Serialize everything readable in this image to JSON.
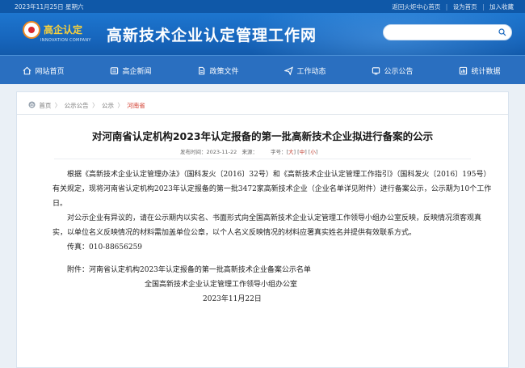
{
  "topbar": {
    "date": "2023年11月25日  星期六",
    "links": [
      "返回火炬中心首页",
      "设为首页",
      "加入收藏"
    ],
    "separator": "|"
  },
  "header": {
    "logo_cn": "高企认定",
    "logo_en": "INNOVATION COMPANY",
    "site_title": "高新技术企业认定管理工作网",
    "search_placeholder": ""
  },
  "nav": {
    "items": [
      {
        "label": "网站首页",
        "icon": "home-icon"
      },
      {
        "label": "高企新闻",
        "icon": "news-icon"
      },
      {
        "label": "政策文件",
        "icon": "document-icon"
      },
      {
        "label": "工作动态",
        "icon": "send-icon"
      },
      {
        "label": "公示公告",
        "icon": "announcement-icon"
      },
      {
        "label": "统计数据",
        "icon": "statistics-icon"
      }
    ]
  },
  "breadcrumb": {
    "items": [
      "首页",
      "公示公告",
      "公示"
    ],
    "current": "河南省",
    "separator": "〉"
  },
  "article": {
    "title": "对河南省认定机构2023年认定报备的第一批高新技术企业拟进行备案的公示",
    "pub_label": "发布时间：",
    "pub_date": "2023-11-22",
    "pub_suffix": "来源：",
    "font_label": "字号：",
    "font_large": "大",
    "font_medium": "中",
    "font_small": "小",
    "paragraphs": [
      "根据《高新技术企业认定管理办法》（国科发火〔2016〕32号）和《高新技术企业认定管理工作指引》（国科发火〔2016〕195号）有关规定，现将河南省认定机构2023年认定报备的第一批3472家高新技术企业（企业名单详见附件）进行备案公示，公示期为10个工作日。",
      "对公示企业有异议的，请在公示期内以实名、书面形式向全国高新技术企业认定管理工作领导小组办公室反映，反映情况须客观真实，以单位名义反映情况的材料需加盖单位公章，以个人名义反映情况的材料应署真实姓名并提供有效联系方式。",
      "传真：010-88656259"
    ],
    "attachment": "附件：河南省认定机构2023年认定报备的第一批高新技术企业备案公示名单",
    "signature_org": "全国高新技术企业认定管理工作领导小组办公室",
    "signature_date": "2023年11月22日"
  },
  "colors": {
    "topbar": "#0f58a8",
    "header": "#1766bd",
    "nav": "#2a6fc0",
    "breadcrumb_current": "#d13a2b",
    "logo_text": "#fbd23a"
  }
}
